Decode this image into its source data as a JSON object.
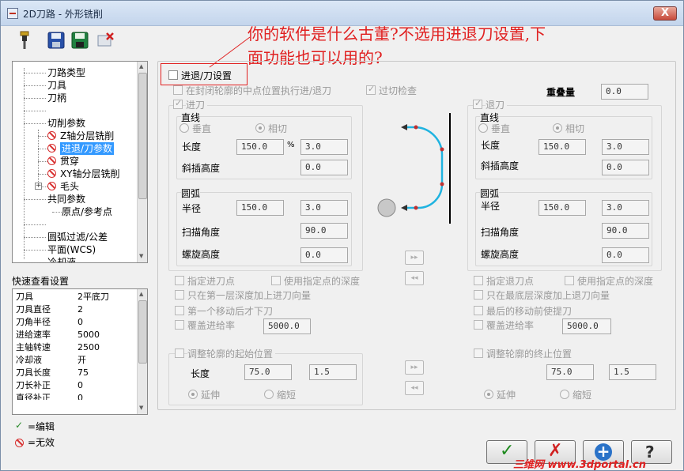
{
  "window": {
    "title": "2D刀路 - 外形铣削",
    "close_label": "X"
  },
  "toolbar": {
    "icons": [
      "tool-icon",
      "save-icon",
      "save-all-icon",
      "delete-icon"
    ]
  },
  "annotation": {
    "line1": "你的软件是什么古董?不选用进退刀设置,下",
    "line2": "面功能也可以用的?"
  },
  "tree": {
    "items": [
      {
        "label": "刀路类型"
      },
      {
        "label": "刀具"
      },
      {
        "label": "刀柄"
      },
      {
        "label": "切削参数"
      },
      {
        "label": "Z轴分层铣削"
      },
      {
        "label": "进退/刀参数"
      },
      {
        "label": "贯穿"
      },
      {
        "label": "XY轴分层铣削"
      },
      {
        "label": "毛头"
      },
      {
        "label": "共同参数"
      },
      {
        "label": "原点/参考点"
      },
      {
        "label": "圆弧过滤/公差"
      },
      {
        "label": "平面(WCS)"
      },
      {
        "label": "冷却液"
      }
    ]
  },
  "quick_view": {
    "title": "快速查看设置",
    "rows": [
      {
        "k": "刀具",
        "v": "2平底刀"
      },
      {
        "k": "刀具直径",
        "v": "2"
      },
      {
        "k": "刀角半径",
        "v": "0"
      },
      {
        "k": "进给速率",
        "v": "5000"
      },
      {
        "k": "主轴转速",
        "v": "2500"
      },
      {
        "k": "冷却液",
        "v": "开"
      },
      {
        "k": "刀具长度",
        "v": "75"
      },
      {
        "k": "刀长补正",
        "v": "0"
      },
      {
        "k": "直径补正",
        "v": "0"
      }
    ]
  },
  "legend": {
    "edit": "=编辑",
    "invalid": "=无效"
  },
  "main": {
    "enter_exit_label": "进退/刀设置",
    "closed_midpoint_label": "在封闭轮廓的中点位置执行进/退刀",
    "gouge_check_label": "过切检查",
    "overlap_label": "重叠量",
    "overlap_value": "0.0",
    "entry": {
      "title": "进刀",
      "line_title": "直线",
      "perpendicular": "垂直",
      "tangent": "相切",
      "length_label": "长度",
      "length_pct": "150.0",
      "pct_sign": "%",
      "length_val": "3.0",
      "ramp_label": "斜插高度",
      "ramp_val": "0.0",
      "arc_title": "圆弧",
      "radius_label": "半径",
      "radius_pct": "150.0",
      "radius_val": "3.0",
      "sweep_label": "扫描角度",
      "sweep_val": "90.0",
      "helix_label": "螺旋高度",
      "helix_val": "0.0",
      "point_label": "指定进刀点",
      "use_depth_label": "使用指定点的深度",
      "first_depth_label": "只在第一层深度加上进刀向量",
      "after_first_move_label": "第一个移动后才下刀",
      "override_feed_label": "覆盖进给率",
      "feed_val": "5000.0",
      "adjust_label": "调整轮廓的起始位置",
      "adj_len_label": "长度",
      "adj_len_val": "75.0",
      "adj_len_val2": "1.5",
      "extend_label": "延伸",
      "shorten_label": "缩短"
    },
    "exit": {
      "title": "退刀",
      "line_title": "直线",
      "perpendicular": "垂直",
      "tangent": "相切",
      "length_label": "长度",
      "length_pct": "150.0",
      "length_val": "3.0",
      "ramp_label": "斜插高度",
      "ramp_val": "0.0",
      "arc_title": "圆弧",
      "radius_label": "半径",
      "radius_pct": "150.0",
      "radius_val": "3.0",
      "sweep_label": "扫描角度",
      "sweep_val": "90.0",
      "helix_label": "螺旋高度",
      "helix_val": "0.0",
      "point_label": "指定退刀点",
      "use_depth_label": "使用指定点的深度",
      "last_depth_label": "只在最底层深度加上退刀向量",
      "lift_before_label": "最后的移动前使提刀",
      "override_feed_label": "覆盖进给率",
      "feed_val": "5000.0",
      "adjust_label": "调整轮廓的终止位置",
      "adj_len_val": "75.0",
      "adj_len_val2": "1.5",
      "extend_label": "延伸",
      "shorten_label": "缩短"
    }
  },
  "buttons": {
    "ok": "✓",
    "cancel": "✗",
    "add": "+",
    "help": "?"
  },
  "watermark": "三维网 www.3dportal.cn",
  "colors": {
    "selection": "#3399ff",
    "annotation": "#e02020",
    "invalid": "#d83030",
    "edit": "#2a8a2a"
  }
}
